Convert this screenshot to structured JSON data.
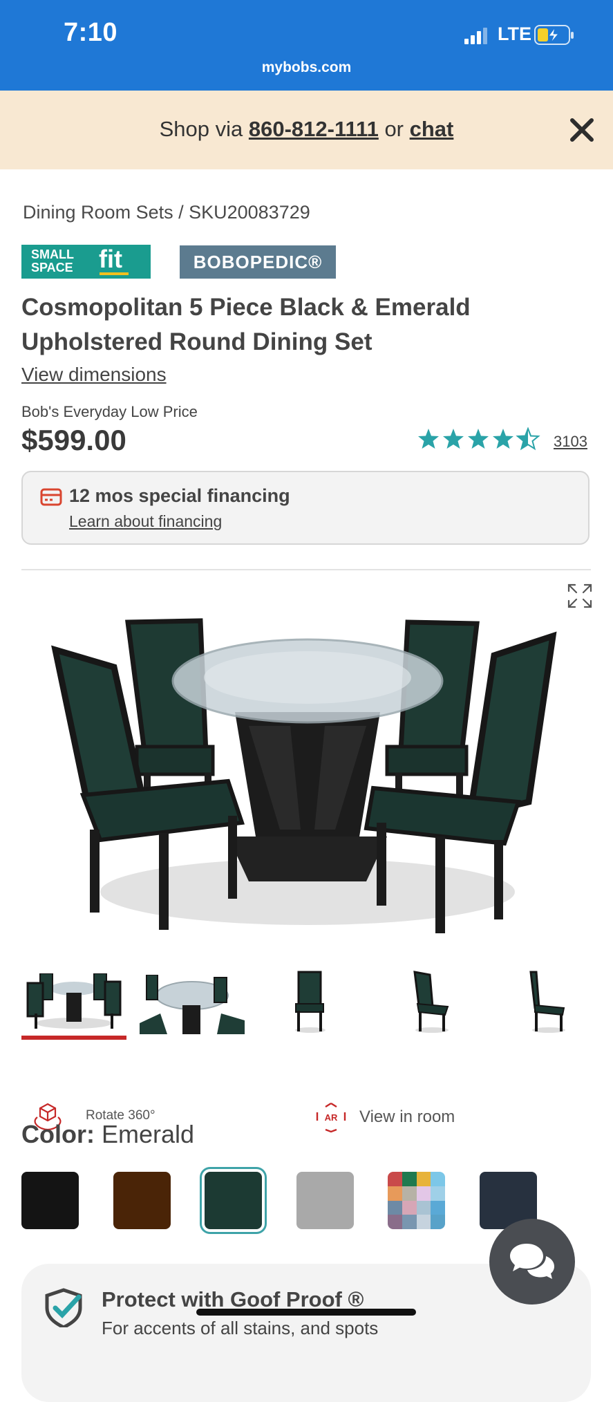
{
  "status_bar": {
    "time": "7:10",
    "network": "LTE",
    "url": "mybobs.com"
  },
  "banner": {
    "prefix": "Shop via ",
    "phone": "860-812-1111",
    "middle": " or ",
    "chat": "chat"
  },
  "breadcrumb": "Dining Room Sets /  SKU20083729",
  "badges": {
    "ssf_small": "SMALL",
    "ssf_space": "SPACE",
    "ssf_fit": "fit",
    "bobopedic": "BOBOPEDIC®"
  },
  "product": {
    "title": "Cosmopolitan 5 Piece Black & Emerald Upholstered Round Dining Set",
    "view_dimensions": "View dimensions",
    "price_label": "Bob's Everyday Low Price",
    "price": "$599.00",
    "rating": 4.5,
    "review_count": "3103"
  },
  "financing": {
    "title": "12 mos special financing",
    "link": "Learn about financing"
  },
  "media": {
    "rotate_label": "Rotate 360°",
    "ar_label": "View in room",
    "ar_icon_text": "AR",
    "selected_thumbnail": 1
  },
  "color": {
    "label": "Color:",
    "value": "Emerald"
  },
  "swatches": [
    "#141414",
    "#4a2407",
    "#1c3a33",
    "#a9a9a9",
    "multi",
    "#27313f"
  ],
  "goof_proof": {
    "title": "Protect with Goof Proof ®",
    "subtitle": "For accents of all stains, and spots"
  },
  "colors": {
    "status_bar": "#1f78d6",
    "banner": "#f8e8d2",
    "accent_teal": "#1a9c8f",
    "selected_red": "#c62828",
    "star": "#2aa3a8"
  }
}
